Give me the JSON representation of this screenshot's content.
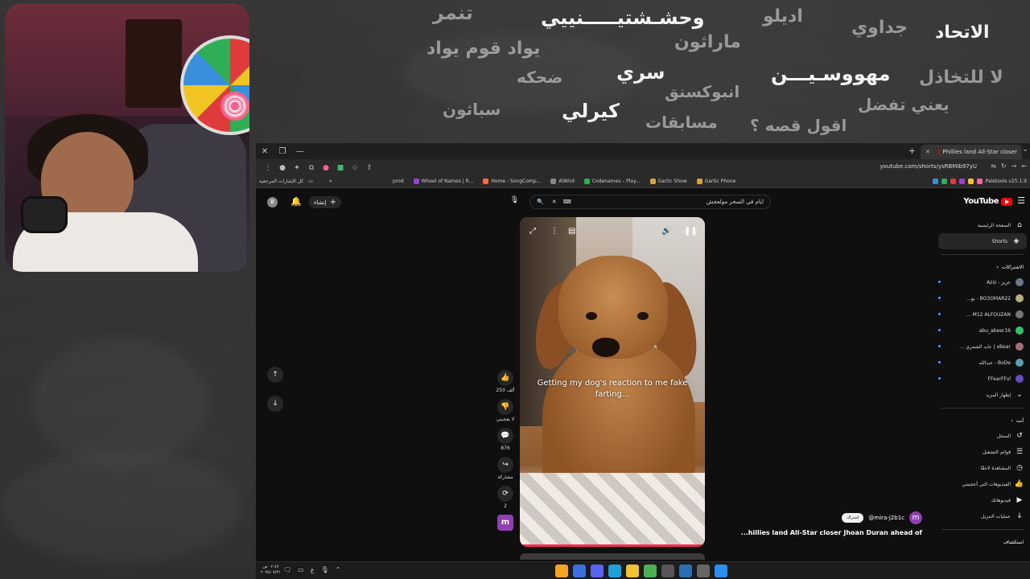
{
  "overlay": {
    "words": [
      "تنمر",
      "وحشـشتيـــــنييي",
      "اديلو",
      "جداوي",
      "الاتحاد",
      "يواد قوم يواد",
      "ماراثون",
      "ضحكه",
      "سري",
      "مهووسـيـــن",
      "لا للتخاذل",
      "سباثون",
      "كيرلي",
      "انبوكسنق",
      "مسابقات",
      "اقول قصه ؟",
      "يعني تفضل"
    ]
  },
  "browser": {
    "tab_title": "Phillies land All-Star closer",
    "url": "youtube.com/shorts/ysRBMIb97yU",
    "bookmarks_label": "كل الإشارات المرجعية",
    "bookmarks": [
      "prod",
      "Wheel of Names | R...",
      "Home - SongComp...",
      "AlWird",
      "Codenames – Play...",
      "Gartic Show",
      "Gartic Phone"
    ],
    "extension_label": "Paletools v25.1.9"
  },
  "youtube": {
    "avatar_letter": "B",
    "create_label": "إنشاء",
    "search_query": "ايام في السحر مولعجش",
    "logo_text": "YouTube",
    "sidebar": {
      "home": "الصفحة الرئيسية",
      "shorts": "Shorts",
      "subs_header": "الاشتراكات",
      "subscriptions": [
        {
          "name": "عزيز - Aziz",
          "color": "#6a7a8c"
        },
        {
          "name": "BO3OMAR22 - بو...",
          "color": "#b8b27a"
        },
        {
          "name": "M12 ALFOUZAN ...",
          "color": "#777777"
        },
        {
          "name": "abu_abeer16",
          "color": "#2fc36a"
        },
        {
          "name": "xBear | عابد الشمري ...",
          "color": "#a07070"
        },
        {
          "name": "BoDe - عبدالله",
          "color": "#5aa0b0"
        },
        {
          "name": "FFearFFul",
          "color": "#6a4cc0"
        }
      ],
      "show_more": "إظهار المزيد",
      "you_header": "أنت",
      "you_items": [
        {
          "label": "السجل",
          "icon": "↺"
        },
        {
          "label": "قوائم التشغيل",
          "icon": "☰"
        },
        {
          "label": "المشاهدة لاحقًا",
          "icon": "◷"
        },
        {
          "label": "الفيديوهات التي أعجبتني",
          "icon": "👍"
        },
        {
          "label": "فيديوهاتك",
          "icon": "▶"
        },
        {
          "label": "عمليات التنزيل",
          "icon": "↓"
        }
      ],
      "explore_header": "استكشاف"
    },
    "short": {
      "caption": "Getting my dog's reaction to me fake farting...",
      "likes": "250 ألف",
      "dislike_label": "لا يعجبني",
      "comments": "876",
      "share_label": "مشاركة",
      "remix_count": "2",
      "channel_letter": "m"
    },
    "next_meta": {
      "handle": "@mira-j2b1c",
      "subscribe_label": "اشتراك",
      "title": "...hillies land All-Star closer Jhoan Duran ahead of"
    }
  },
  "taskbar": {
    "time": "٠٢:٤٧ ص",
    "date": "٢٠٢٥/٠٧/٣١",
    "lang": "ع"
  }
}
